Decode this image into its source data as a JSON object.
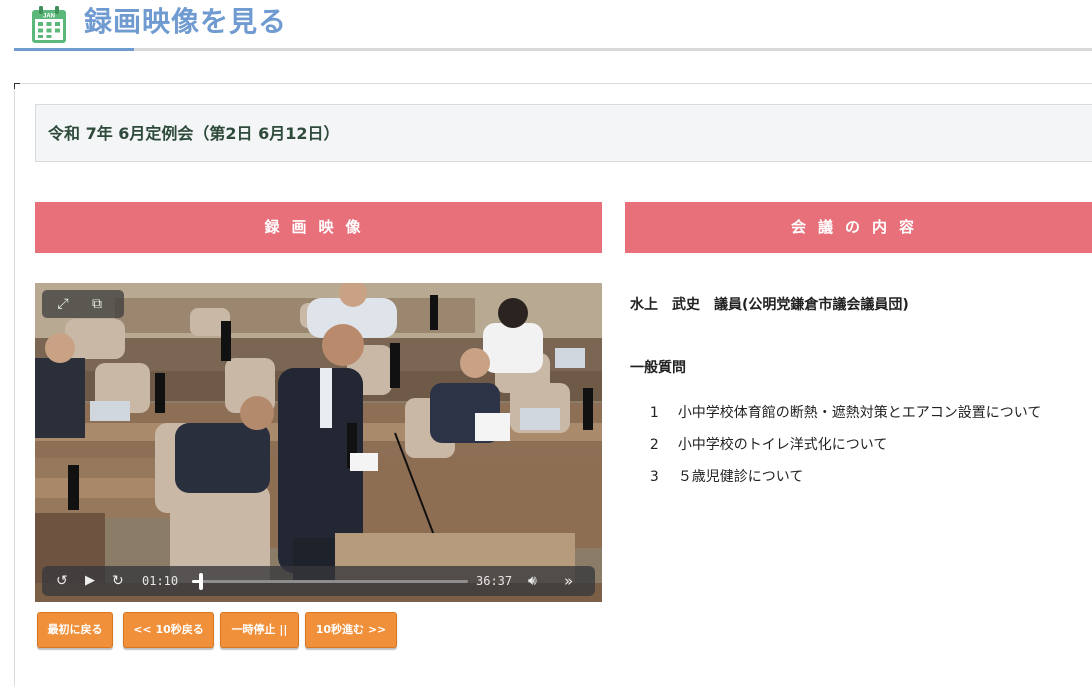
{
  "page": {
    "title": "録画映像を見る",
    "calendar_icon": "calendar-icon",
    "calendar_label": "JAN"
  },
  "meeting": {
    "title": "令和 7年 6月定例会（第2日 6月12日）"
  },
  "sections": {
    "video_header": "録画映像",
    "content_header": "会議の内容"
  },
  "player": {
    "current_time": "01:10",
    "duration": "36:37",
    "progress": 0.032,
    "icons": [
      "fullscreen-icon",
      "picture-in-picture-icon",
      "rewind-15-icon",
      "play-icon",
      "forward-15-icon",
      "volume-icon",
      "skip-forward-icon"
    ]
  },
  "controls": {
    "to_start": "最初に戻る",
    "back_10": "<< 10秒戻る",
    "pause": "一時停止 ||",
    "forward_10": "10秒進む >>"
  },
  "agenda": {
    "member": "水上　武史　議員(公明党鎌倉市議会議員団)",
    "heading": "一般質問",
    "items": [
      {
        "num": "1",
        "text": "小中学校体育館の断熱・遮熱対策とエアコン設置について"
      },
      {
        "num": "2",
        "text": "小中学校のトイレ洋式化について"
      },
      {
        "num": "3",
        "text": "５歳児健診について"
      }
    ]
  },
  "colors": {
    "title_blue": "#6f9bd1",
    "section_pink": "#e8707a",
    "button_orange": "#f0903a",
    "calendar_green": "#5cb87a"
  }
}
